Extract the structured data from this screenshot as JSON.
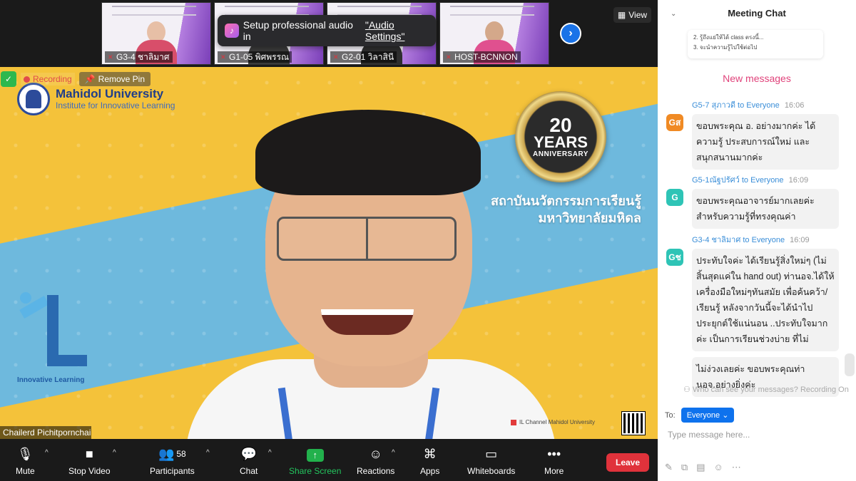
{
  "thumbnails": [
    {
      "name": "G3-4 ชาลิมาศ",
      "skin": "#e7bfa6",
      "cloth": "#d84e6a"
    },
    {
      "name": "G1-05 พิศพรรณ",
      "skin": "#c9a184",
      "cloth": "#3b3b3b"
    },
    {
      "name": "G2-01 วิลาสินี",
      "skin": "#c9a184",
      "cloth": "#2e2e2e"
    },
    {
      "name": "HOST-BCNNON",
      "skin": "#d4a88a",
      "cloth": "#e0508f"
    }
  ],
  "audio_toast": {
    "text": "Setup professional audio in",
    "link": "\"Audio Settings\""
  },
  "view_label": "View",
  "status": {
    "recording": "Recording",
    "remove_pin": "Remove Pin"
  },
  "slide": {
    "university": "Mahidol University",
    "institute": "Institute for Innovative Learning",
    "anniv_number": "20",
    "anniv_years": "YEARS",
    "anniv_word": "ANNIVERSARY",
    "thai_line1": "สถาบันนวัตกรรมการเรียนรู้",
    "thai_line2": "มหาวิทยาลัยมหิดล",
    "il_text": "Innovative Learning",
    "channel": "IL Channel Mahidol University"
  },
  "speaker_name": "Chailerd Pichitpornchai",
  "toolbar": {
    "mute": "Mute",
    "stop_video": "Stop Video",
    "participants": "Participants",
    "participants_count": "58",
    "chat": "Chat",
    "share_screen": "Share Screen",
    "reactions": "Reactions",
    "apps": "Apps",
    "whiteboards": "Whiteboards",
    "more": "More",
    "leave": "Leave"
  },
  "chat": {
    "title": "Meeting Chat",
    "prev_line1": "2. รู้ถึงแย่ให้ได้ class ตรงนี้...",
    "prev_line2": "3. จะนำความรู้ไปใช้ต่อไป",
    "new_messages": "New messages",
    "messages": [
      {
        "sender": "G5-7 สุภาวดี",
        "to": "to Everyone",
        "time": "16:06",
        "avatar": "Gส",
        "avatar_color": "#f08a24",
        "text": "ขอบพระคุณ อ. อย่างมากค่ะ  ได้ความรู้ ประสบการณ์ใหม่ และสนุกสนานมากค่ะ"
      },
      {
        "sender": "G5-1ณัฐปรัศว์",
        "to": "to Everyone",
        "time": "16:09",
        "avatar": "G",
        "avatar_color": "#2ec4b6",
        "text": "ขอบพระคุณอาจารย์มากเลยค่ะ สำหรับความรู้ที่ทรงคุณค่า"
      },
      {
        "sender": "G3-4 ชาลิมาศ",
        "to": "to Everyone",
        "time": "16:09",
        "avatar": "Gช",
        "avatar_color": "#2ec4b6",
        "text": "ประทับใจค่ะ ได้เรียนรู้สิ่งใหม่ๆ  (ไม่สิ้นสุดแค่ใน hand out) ท่านอจ.ได้ให้เครื่องมือใหม่ๆทันสมัย เพื่อค้นคว้า/เรียนรู้ หลังจากวันนี้จะได้นำไปประยุกต์ใช้แน่นอน ..ประทับใจมากค่ะ เป็นการเรียนช่วงบ่าย ที่ไม่",
        "extra": "ไม่ง่วงเลยค่ะ ขอบพระคุณท่านอจ.อย่างยิ่งค่ะ"
      }
    ],
    "privacy": "Who can see your messages? Recording On",
    "to_label": "To:",
    "recipient": "Everyone",
    "input_placeholder": "Type message here..."
  }
}
